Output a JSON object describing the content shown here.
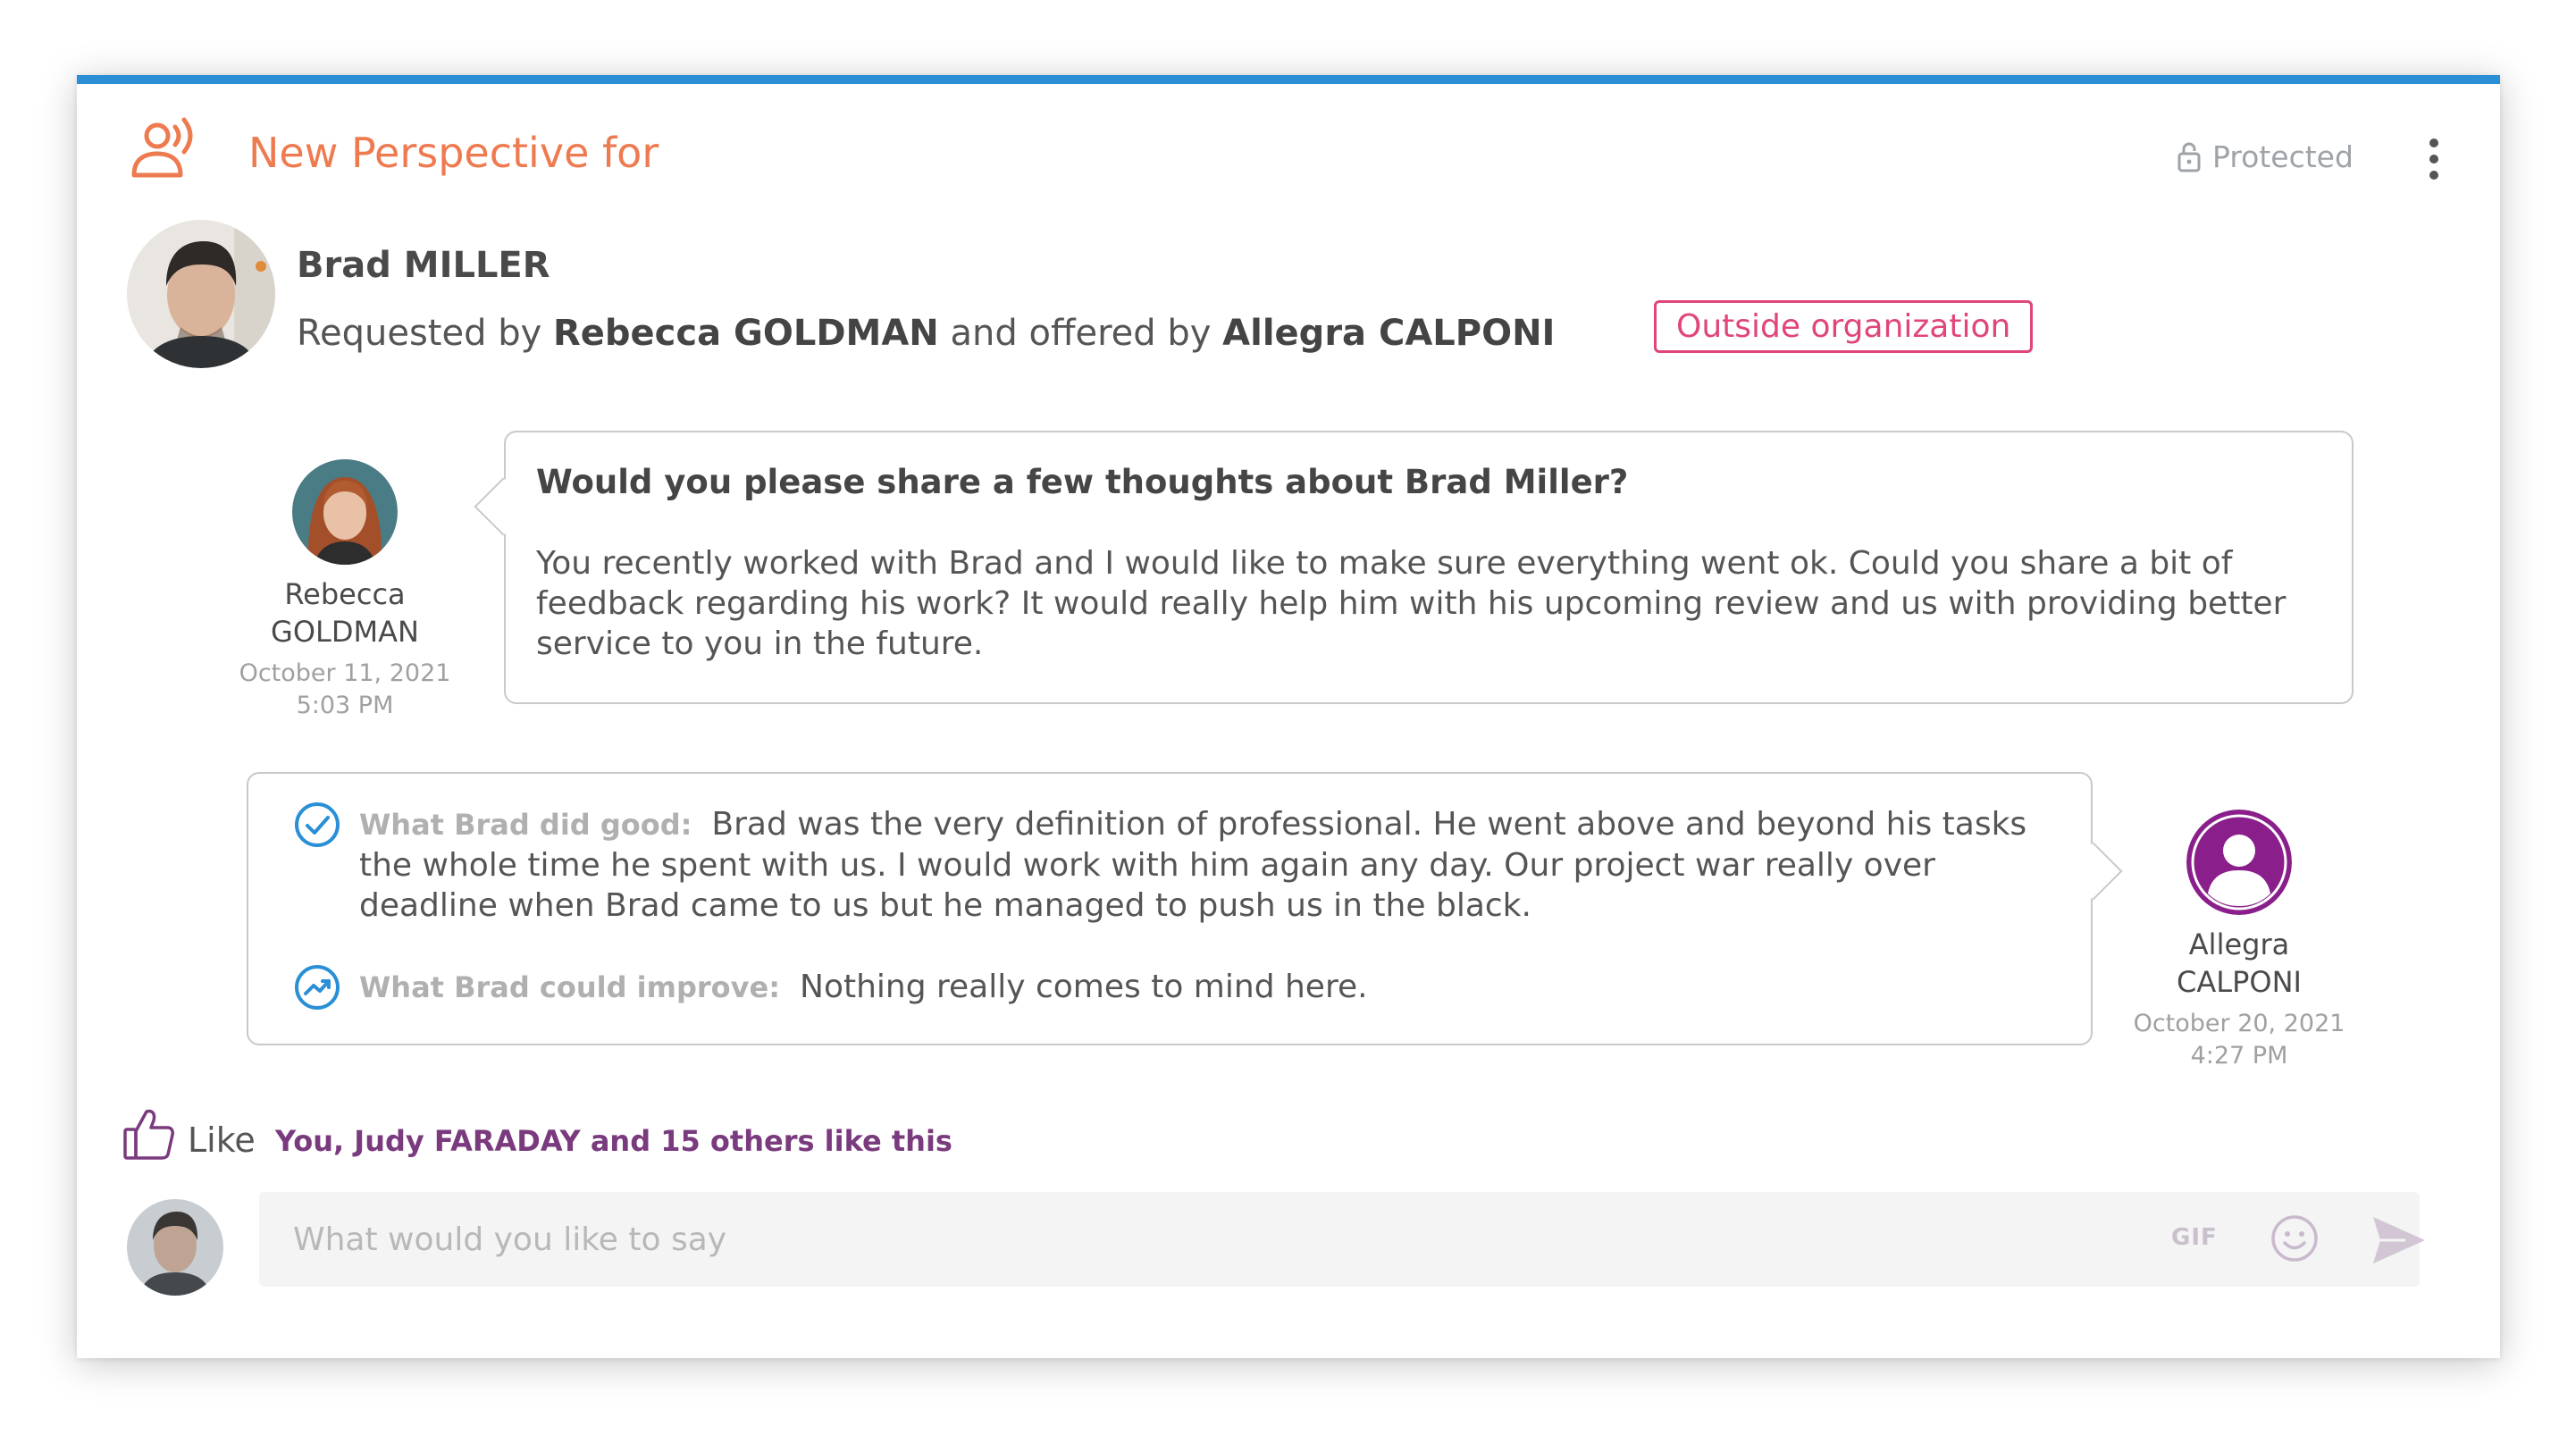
{
  "header": {
    "title": "New Perspective for",
    "protected_label": "Protected"
  },
  "subject": {
    "name": "Brad MILLER",
    "request_prefix": "Requested by",
    "requester": "Rebecca GOLDMAN",
    "request_middle": "and offered by",
    "offerer": "Allegra CALPONI",
    "badge": "Outside organization"
  },
  "request": {
    "author_first": "Rebecca",
    "author_last": "GOLDMAN",
    "date": "October 11, 2021",
    "time": "5:03 PM",
    "question": "Would you please share a few thoughts about Brad Miller?",
    "body": "You recently worked with Brad and I would like to make sure everything went ok. Could you share a bit of feedback regarding his work? It would really help him with his upcoming review and us with providing better service to you in the future."
  },
  "response": {
    "author_first": "Allegra",
    "author_last": "CALPONI",
    "date": "October 20, 2021",
    "time": "4:27 PM",
    "good_label": "What Brad did good:",
    "good_text": "Brad was the very definition of professional. He went above and beyond his tasks the whole time he spent with us. I would work with him again any day. Our project war really over deadline when Brad came to us but he managed to push us in the black.",
    "improve_label": "What Brad could improve:",
    "improve_text": "Nothing really comes to mind here."
  },
  "likes": {
    "label": "Like",
    "summary": "You, Judy FARADAY and 15 others like this"
  },
  "comment": {
    "placeholder": "What would you like to say",
    "gif_label": "GIF"
  },
  "colors": {
    "accent_top": "#2a8fd6",
    "header_orange": "#ee7a50",
    "badge_pink": "#e0457b",
    "purple": "#7a3a7e",
    "check_blue": "#2a8fd6"
  },
  "icons": [
    "feedback-icon",
    "lock-icon",
    "more-vertical-icon",
    "check-circle-icon",
    "trend-circle-icon",
    "thumbs-up-icon",
    "emoji-icon",
    "send-icon",
    "person-icon"
  ]
}
